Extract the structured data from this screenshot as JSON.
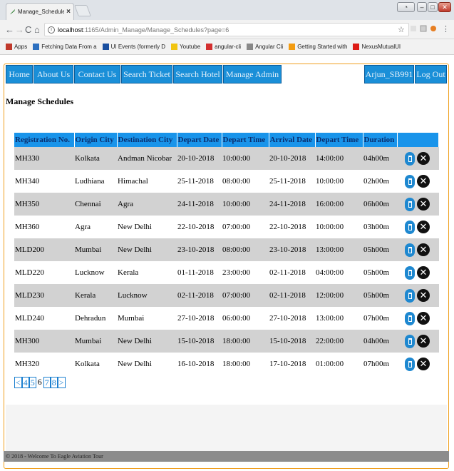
{
  "browser": {
    "tab_title": "Manage_Schedules - My",
    "url_host": "localhost",
    "url_path": ":1165/Admin_Manage/Manage_Schedules?page=6",
    "bookmarks": [
      {
        "label": "Apps",
        "icon": "apps-icon",
        "color": "#c0392b"
      },
      {
        "label": "Fetching Data From a",
        "icon": "page-icon",
        "color": "#2c6fbf"
      },
      {
        "label": "UI Events (formerly D",
        "icon": "ws-icon",
        "color": "#1a4fa0"
      },
      {
        "label": "Youtube",
        "icon": "folder-icon",
        "color": "#f1c40f"
      },
      {
        "label": "angular-cli",
        "icon": "youtube-icon",
        "color": "#d32f2f"
      },
      {
        "label": "Angular Cli",
        "icon": "doc-icon",
        "color": "#888888"
      },
      {
        "label": "Getting Started with",
        "icon": "bolt-icon",
        "color": "#f39c12"
      },
      {
        "label": "NexusMutualUI",
        "icon": "angular-icon",
        "color": "#dd1b16"
      }
    ]
  },
  "nav": {
    "home": "Home",
    "about": "About Us",
    "contact": "Contact Us",
    "search_ticket": "Search Ticket",
    "search_hotel": "Search Hotel",
    "manage_admin": "Manage Admin",
    "user": "Arjun_SB991",
    "logout": "Log Out"
  },
  "page_heading": "Manage Schedules",
  "table": {
    "headers": [
      "Registration No.",
      "Origin City",
      "Destination City",
      "Depart Date",
      "Depart Time",
      "Arrival Date",
      "Depart Time",
      "Duration",
      ""
    ],
    "rows": [
      [
        "MH330",
        "Kolkata",
        "Andman Nicobar",
        "20-10-2018",
        "10:00:00",
        "20-10-2018",
        "14:00:00",
        "04h00m"
      ],
      [
        "MH340",
        "Ludhiana",
        "Himachal",
        "25-11-2018",
        "08:00:00",
        "25-11-2018",
        "10:00:00",
        "02h00m"
      ],
      [
        "MH350",
        "Chennai",
        "Agra",
        "24-11-2018",
        "10:00:00",
        "24-11-2018",
        "16:00:00",
        "06h00m"
      ],
      [
        "MH360",
        "Agra",
        "New Delhi",
        "22-10-2018",
        "07:00:00",
        "22-10-2018",
        "10:00:00",
        "03h00m"
      ],
      [
        "MLD200",
        "Mumbai",
        "New Delhi",
        "23-10-2018",
        "08:00:00",
        "23-10-2018",
        "13:00:00",
        "05h00m"
      ],
      [
        "MLD220",
        "Lucknow",
        "Kerala",
        "01-11-2018",
        "23:00:00",
        "02-11-2018",
        "04:00:00",
        "05h00m"
      ],
      [
        "MLD230",
        "Kerala",
        "Lucknow",
        "02-11-2018",
        "07:00:00",
        "02-11-2018",
        "12:00:00",
        "05h00m"
      ],
      [
        "MLD240",
        "Dehradun",
        "Mumbai",
        "27-10-2018",
        "06:00:00",
        "27-10-2018",
        "13:00:00",
        "07h00m"
      ],
      [
        "MH300",
        "Mumbai",
        "New Delhi",
        "15-10-2018",
        "18:00:00",
        "15-10-2018",
        "22:00:00",
        "04h00m"
      ],
      [
        "MH320",
        "Kolkata",
        "New Delhi",
        "16-10-2018",
        "18:00:00",
        "17-10-2018",
        "01:00:00",
        "07h00m"
      ]
    ]
  },
  "pager": {
    "prev": "<",
    "pages": [
      "4",
      "5",
      "6",
      "7",
      "8"
    ],
    "current": "6",
    "next": ">"
  },
  "footer": "© 2018 - Welcome To Eagle Aviation Tour",
  "colors": {
    "nav_bg": "#1a8fd8",
    "header_bg": "#1994ea",
    "row_alt": "#d2d2d2",
    "frame_border": "#f0a020",
    "footer_bg": "#8c8c8c"
  }
}
